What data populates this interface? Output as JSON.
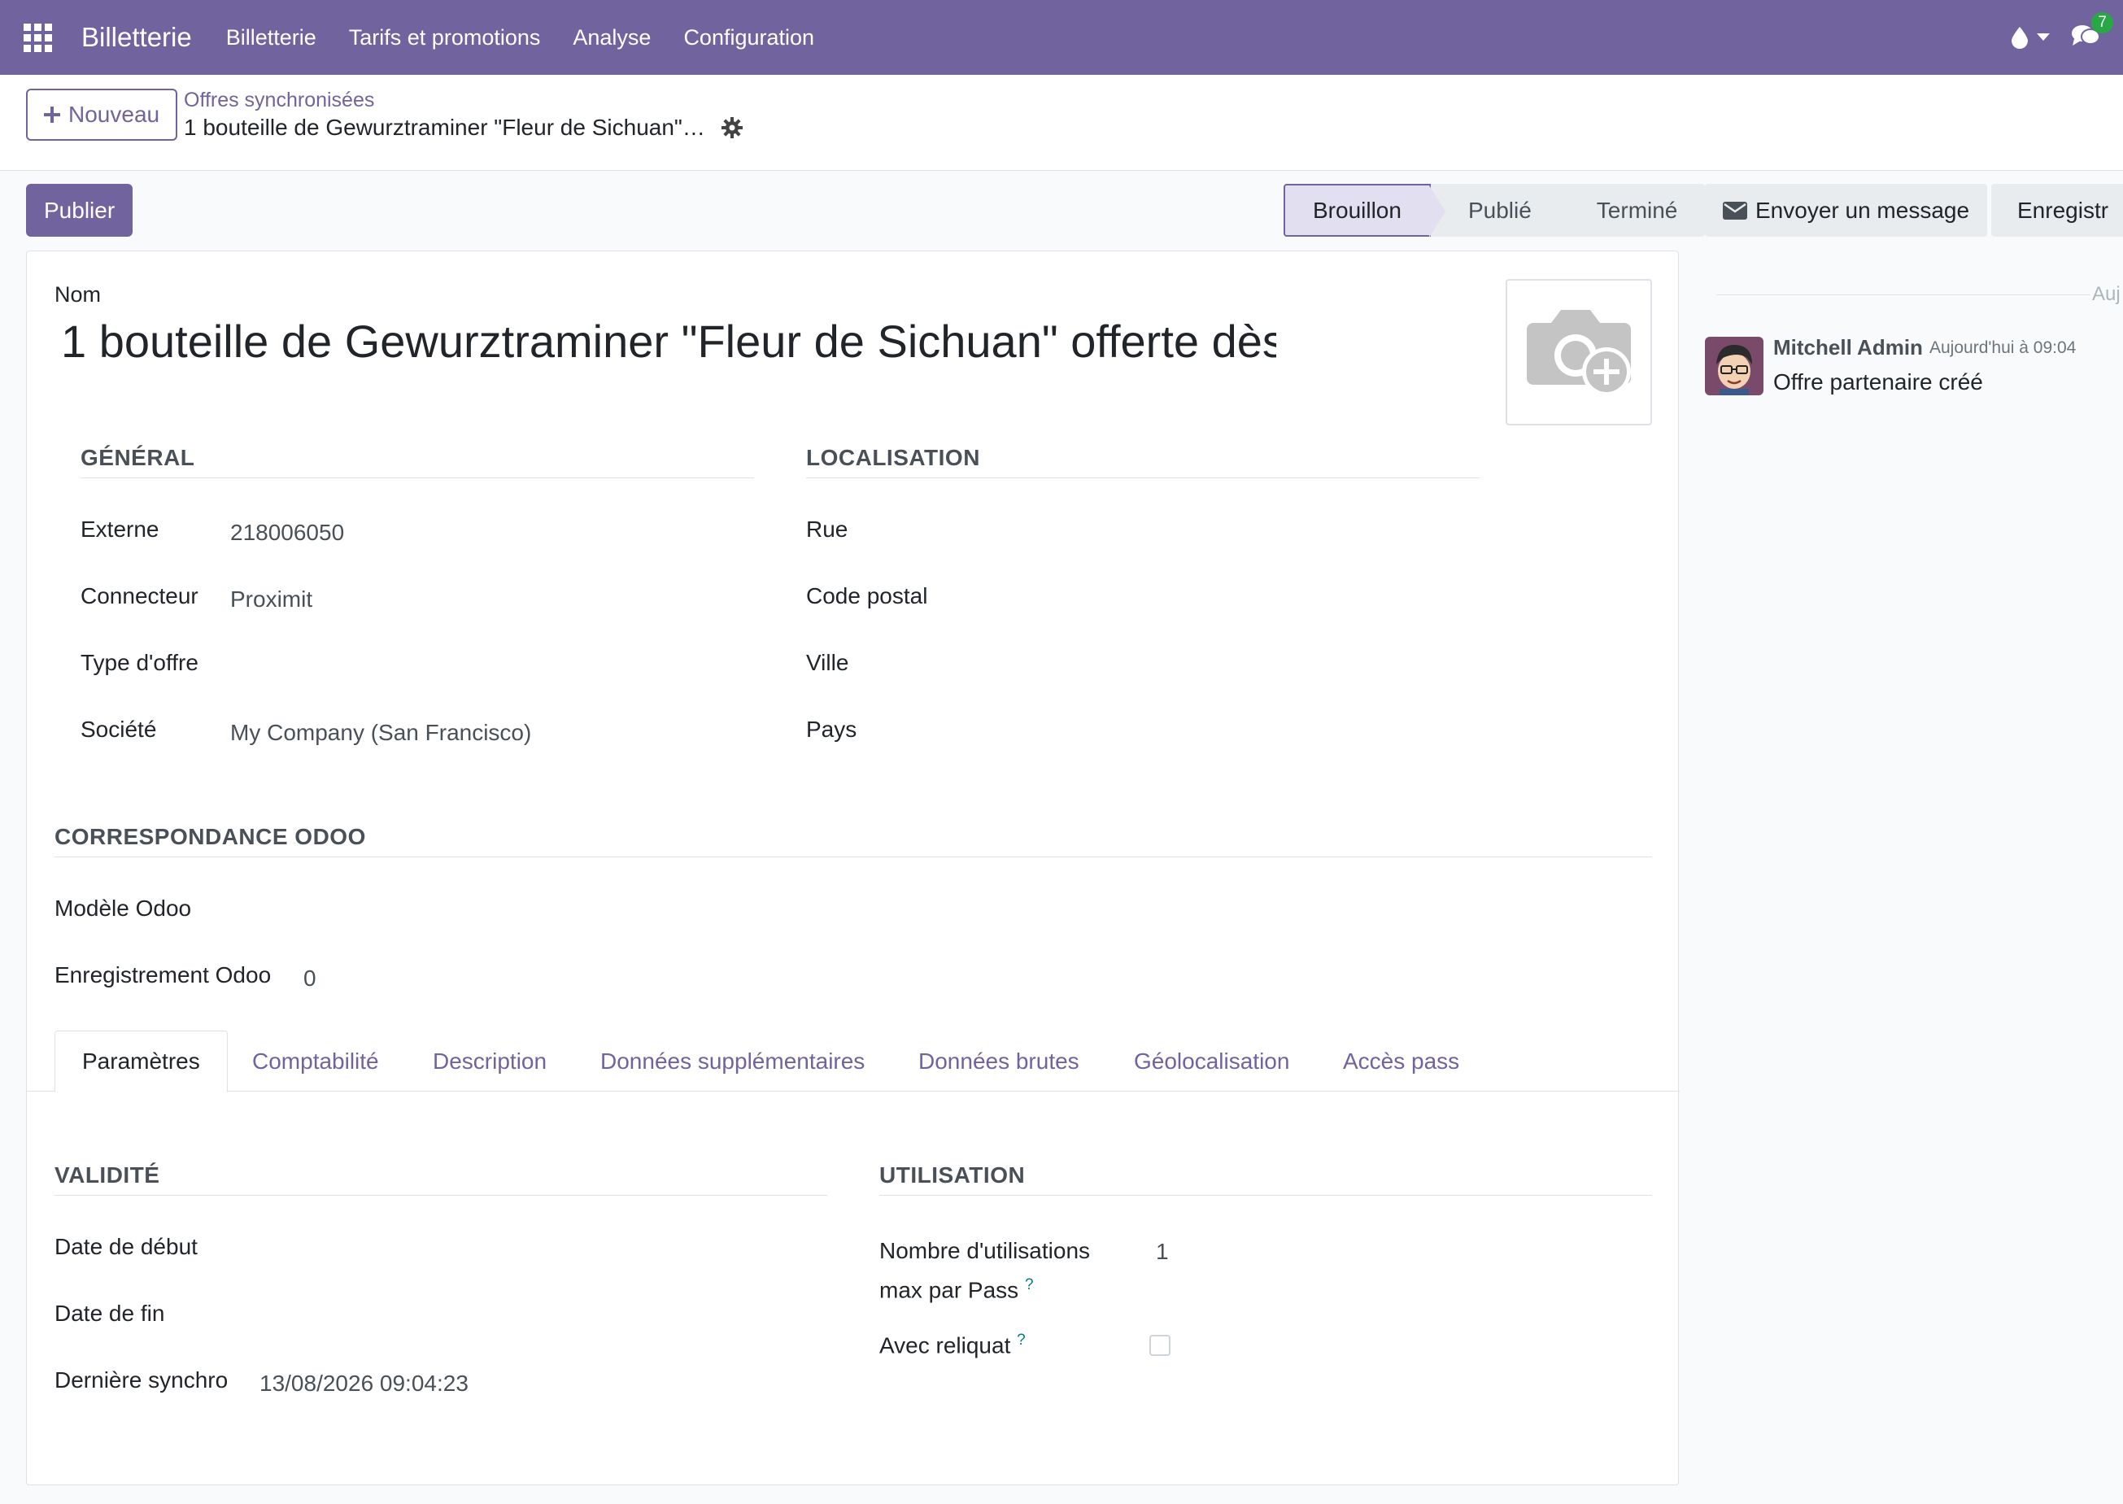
{
  "navbar": {
    "app_name": "Billetterie",
    "menu": [
      "Billetterie",
      "Tarifs et promotions",
      "Analyse",
      "Configuration"
    ],
    "messages_count": "7",
    "color": "#71639e"
  },
  "controls": {
    "new_label": "Nouveau",
    "breadcrumb_parent": "Offres synchronisées",
    "breadcrumb_current": "1 bouteille de Gewurztraminer \"Fleur de Sichuan\"…"
  },
  "actions": {
    "publish_label": "Publier",
    "stages": [
      "Brouillon",
      "Publié",
      "Terminé"
    ],
    "active_stage": "Brouillon",
    "send_message_label": "Envoyer un message",
    "log_note_label": "Enregistr"
  },
  "form": {
    "name_label": "Nom",
    "name_value": "1 bouteille de Gewurztraminer \"Fleur de Sichuan\" offerte dès",
    "general": {
      "title": "GÉNÉRAL",
      "externe_label": "Externe",
      "externe_value": "218006050",
      "connecteur_label": "Connecteur",
      "connecteur_value": "Proximit",
      "type_label": "Type d'offre",
      "type_value": "",
      "societe_label": "Société",
      "societe_value": "My Company (San Francisco)"
    },
    "localisation": {
      "title": "LOCALISATION",
      "rue_label": "Rue",
      "code_label": "Code postal",
      "ville_label": "Ville",
      "pays_label": "Pays"
    },
    "correspondance": {
      "title": "CORRESPONDANCE ODOO",
      "modele_label": "Modèle Odoo",
      "modele_value": "",
      "enreg_label": "Enregistrement Odoo",
      "enreg_value": "0"
    },
    "tabs": [
      "Paramètres",
      "Comptabilité",
      "Description",
      "Données supplémentaires",
      "Données brutes",
      "Géolocalisation",
      "Accès pass"
    ],
    "active_tab": "Paramètres",
    "validite": {
      "title": "VALIDITÉ",
      "debut_label": "Date de début",
      "fin_label": "Date de fin",
      "synchro_label": "Dernière synchro",
      "synchro_value": "13/08/2026 09:04:23"
    },
    "utilisation": {
      "title": "UTILISATION",
      "max_label_1": "Nombre d'utilisations",
      "max_label_2": "max par Pass",
      "max_value": "1",
      "reliquat_label": "Avec reliquat",
      "help_mark": "?"
    }
  },
  "chatter": {
    "date_separator": "Auj",
    "author": "Mitchell Admin",
    "time": "Aujourd'hui à 09:04",
    "body": "Offre partenaire créé"
  }
}
